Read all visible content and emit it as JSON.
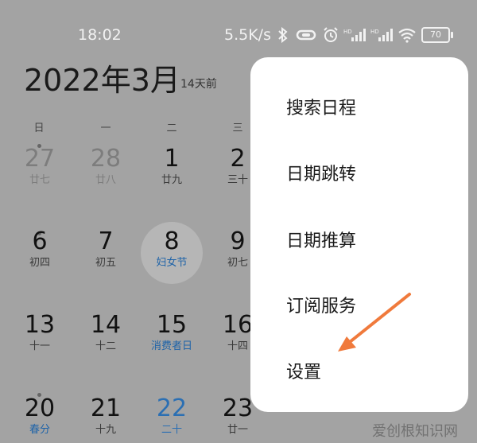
{
  "status_bar": {
    "time": "18:02",
    "net_speed": "5.5K/s",
    "battery": "70",
    "icons": [
      "bluetooth-icon",
      "link-icon",
      "alarm-icon",
      "signal-hd-icon",
      "signal-hd-icon-2",
      "wifi-icon",
      "battery-icon"
    ]
  },
  "header": {
    "title": "2022年3月",
    "subtitle": "14天前"
  },
  "weekdays": [
    "日",
    "一",
    "二",
    "三"
  ],
  "days": [
    {
      "num": "27",
      "lunar": "廿七"
    },
    {
      "num": "28",
      "lunar": "廿八"
    },
    {
      "num": "1",
      "lunar": "廿九"
    },
    {
      "num": "2",
      "lunar": "三十"
    },
    {
      "num": "6",
      "lunar": "初四"
    },
    {
      "num": "7",
      "lunar": "初五"
    },
    {
      "num": "8",
      "lunar": "妇女节"
    },
    {
      "num": "9",
      "lunar": "初七"
    },
    {
      "num": "13",
      "lunar": "十一"
    },
    {
      "num": "14",
      "lunar": "十二"
    },
    {
      "num": "15",
      "lunar": "消费者日"
    },
    {
      "num": "16",
      "lunar": "十四"
    },
    {
      "num": "20",
      "lunar": "春分"
    },
    {
      "num": "21",
      "lunar": "十九"
    },
    {
      "num": "22",
      "lunar": "二十"
    },
    {
      "num": "23",
      "lunar": "廿一"
    }
  ],
  "menu": {
    "items": [
      "搜索日程",
      "日期跳转",
      "日期推算",
      "订阅服务",
      "设置"
    ]
  },
  "watermark": "爱创根知识网",
  "colors": {
    "accent_blue": "#2b6fb3",
    "arrow": "#f07a3c"
  }
}
